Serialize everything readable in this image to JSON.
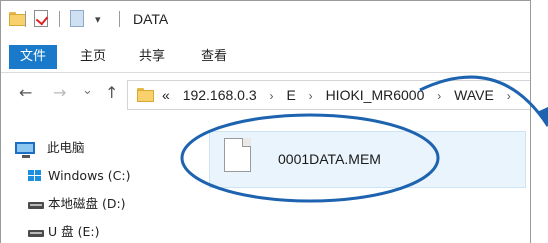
{
  "window": {
    "title": "DATA",
    "quick_access_dropdown": "▾"
  },
  "ribbon": {
    "tabs": [
      "文件",
      "主页",
      "共享",
      "查看"
    ]
  },
  "nav": {
    "back": "←",
    "forward": "→",
    "recent": "⌄",
    "up": "↑"
  },
  "address": {
    "overflow": "«",
    "crumbs": [
      "192.168.0.3",
      "E",
      "HIOKI_MR6000",
      "WAVE"
    ],
    "separator": "›"
  },
  "sidebar": {
    "items": [
      {
        "label": "此电脑",
        "icon": "computer-icon"
      },
      {
        "label": "Windows (C:)",
        "icon": "windows-drive-icon"
      },
      {
        "label": "本地磁盘 (D:)",
        "icon": "drive-icon"
      },
      {
        "label": "U 盘 (E:)",
        "icon": "drive-icon"
      }
    ]
  },
  "content": {
    "file": {
      "name": "0001DATA.MEM",
      "icon": "document-icon"
    }
  },
  "annotation": {
    "shapes": [
      "highlight-ellipse",
      "curved-arrow"
    ],
    "color": "#1d63b0"
  }
}
